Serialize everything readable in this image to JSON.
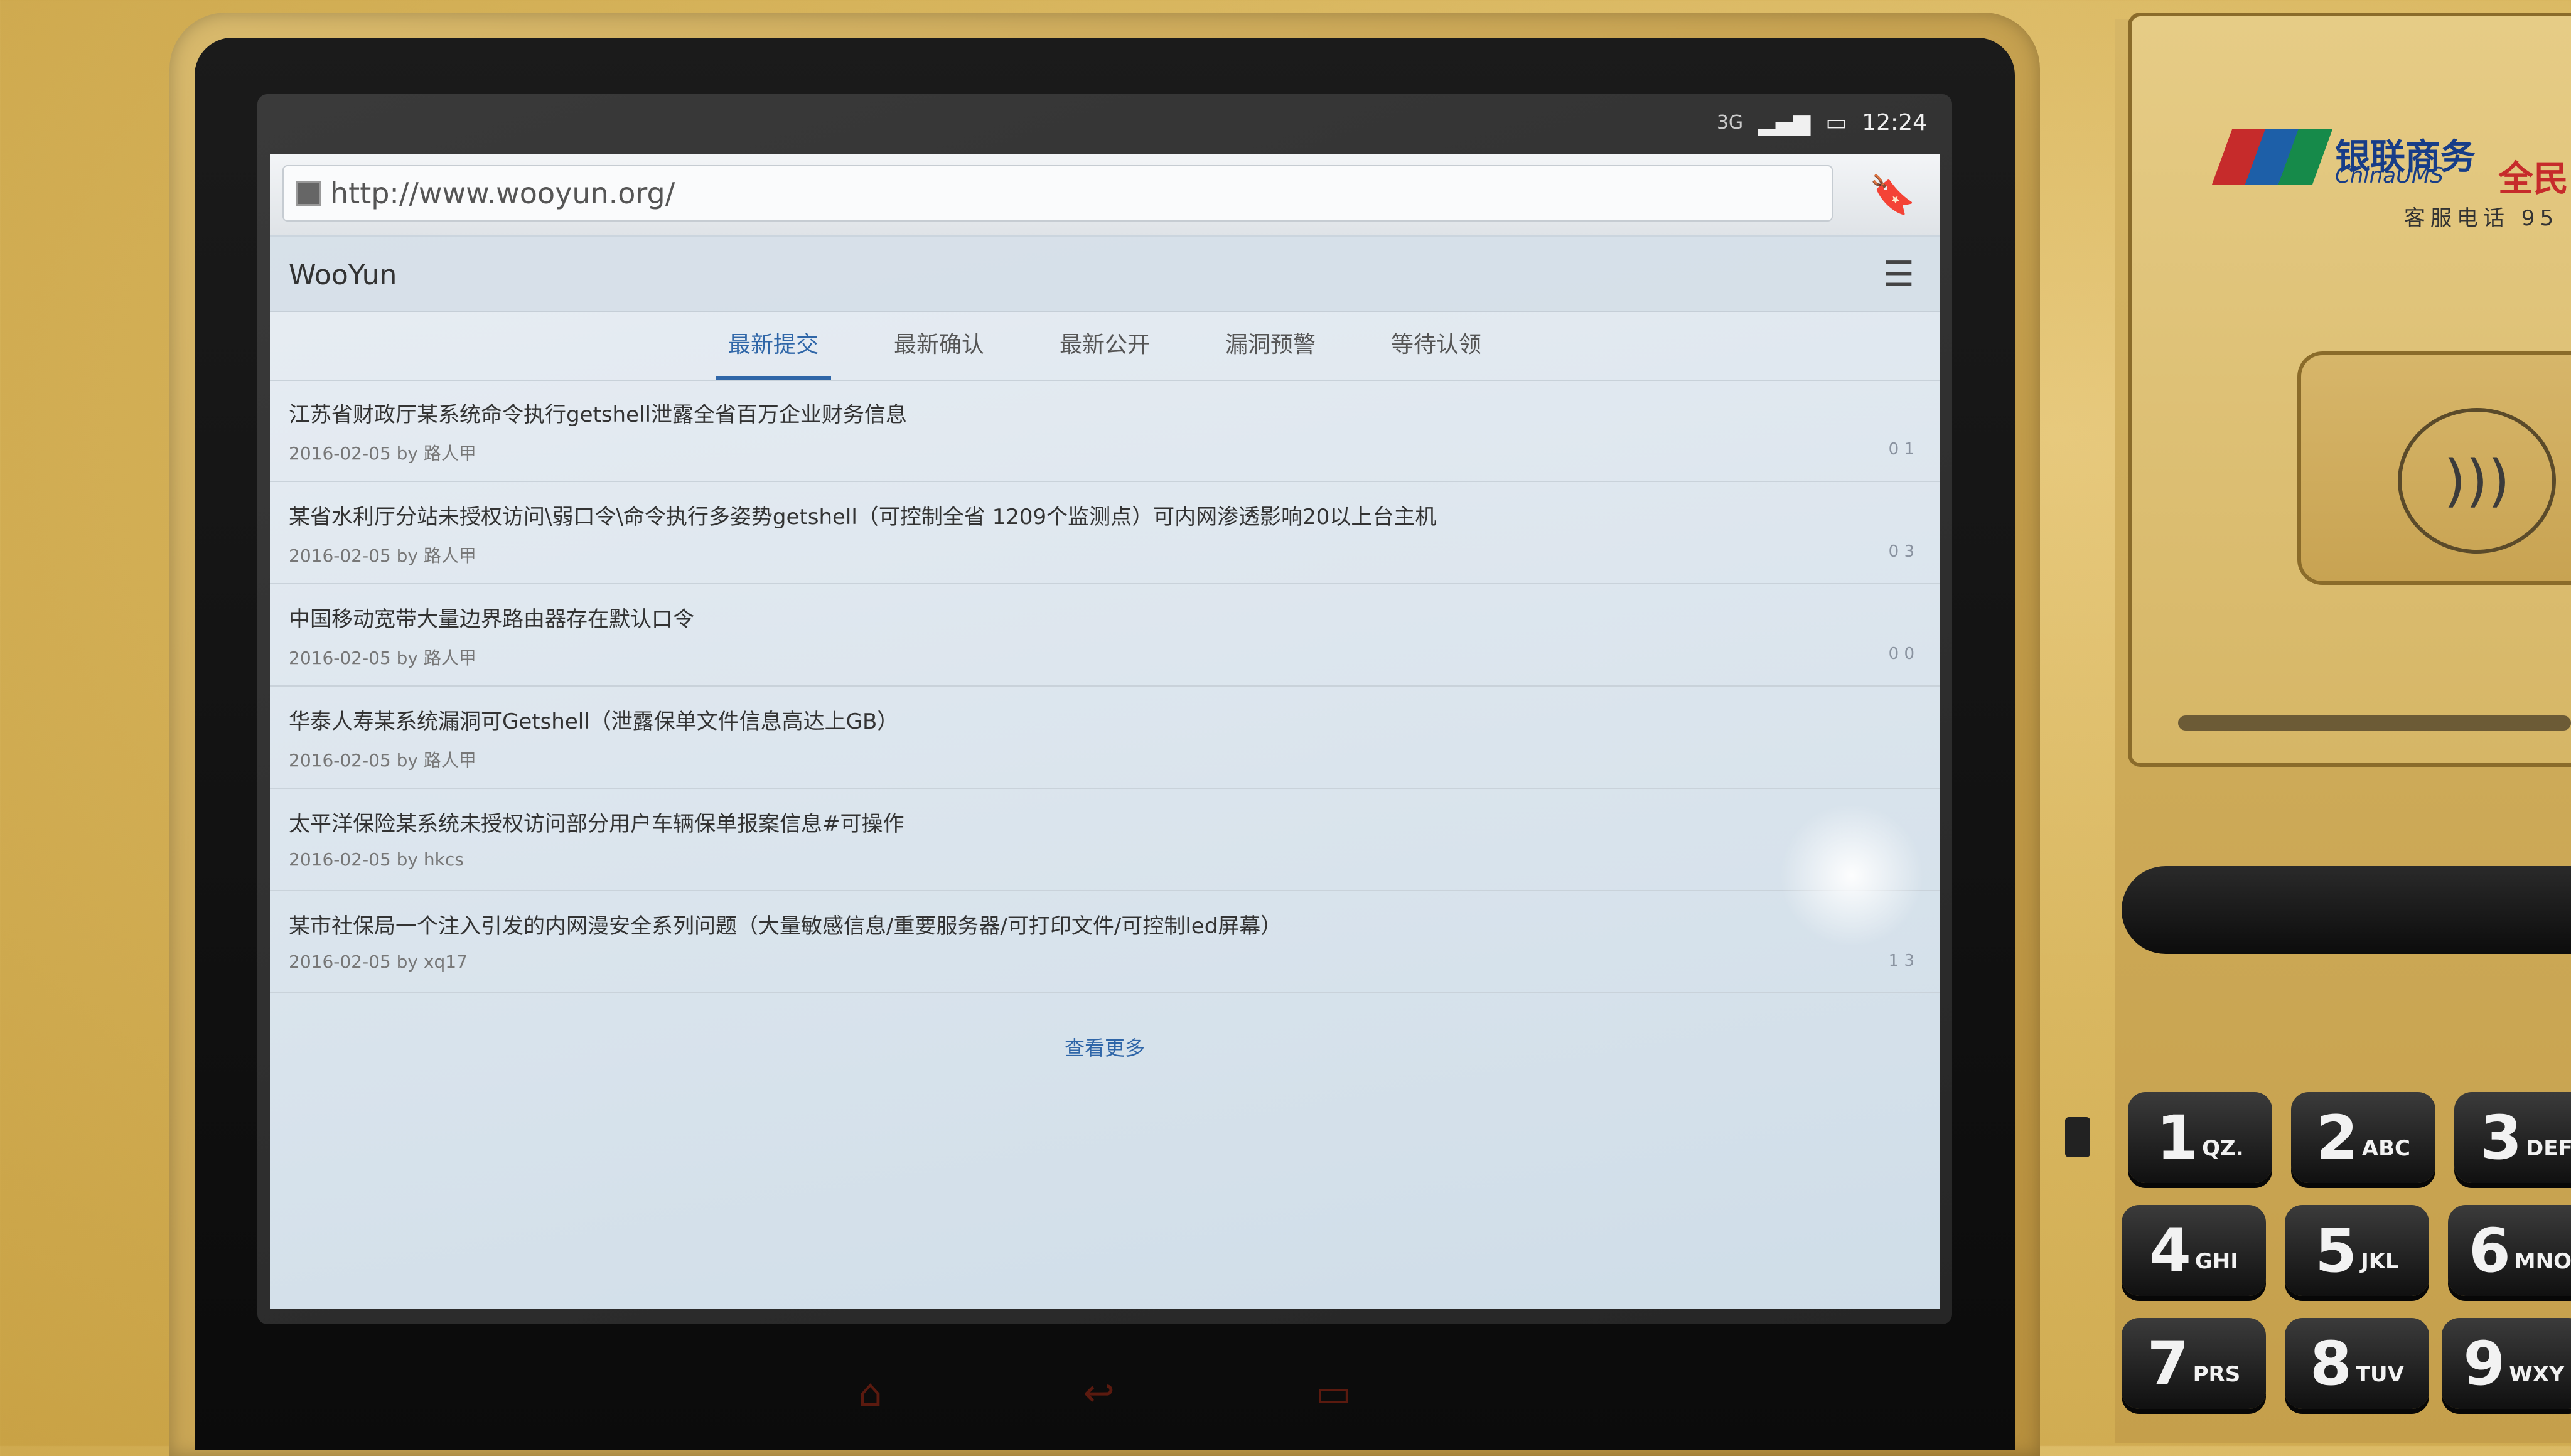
{
  "status": {
    "network": "3G",
    "time": "12:24"
  },
  "browser": {
    "url": "http://www.wooyun.org/",
    "site_name": "WooYun",
    "tabs": [
      {
        "label": "最新提交",
        "active": true
      },
      {
        "label": "最新确认",
        "active": false
      },
      {
        "label": "最新公开",
        "active": false
      },
      {
        "label": "漏洞预警",
        "active": false
      },
      {
        "label": "等待认领",
        "active": false
      }
    ],
    "items": [
      {
        "title": "江苏省财政厅某系统命令执行getshell泄露全省百万企业财务信息",
        "meta": "2016-02-05 by 路人甲",
        "stats": "0  1"
      },
      {
        "title": "某省水利厅分站未授权访问\\弱口令\\命令执行多姿势getshell（可控制全省 1209个监测点）可内网渗透影响20以上台主机",
        "meta": "2016-02-05 by 路人甲",
        "stats": "0  3"
      },
      {
        "title": "中国移动宽带大量边界路由器存在默认口令",
        "meta": "2016-02-05 by 路人甲",
        "stats": "0  0"
      },
      {
        "title": "华泰人寿某系统漏洞可Getshell（泄露保单文件信息高达上GB）",
        "meta": "2016-02-05 by 路人甲",
        "stats": ""
      },
      {
        "title": "太平洋保险某系统未授权访问部分用户车辆保单报案信息#可操作",
        "meta": "2016-02-05 by hkcs",
        "stats": ""
      },
      {
        "title": "某市社保局一个注入引发的内网漫安全系列问题（大量敏感信息/重要服务器/可打印文件/可控制led屏幕）",
        "meta": "2016-02-05 by xq17",
        "stats": "1  3"
      }
    ],
    "more_label": "查看更多"
  },
  "panel": {
    "brand_cn": "银联商务",
    "brand_en": "ChinaUMS",
    "brand_cn2": "全民",
    "hotline": "客服电话 95"
  },
  "keypad": [
    {
      "digit": "1",
      "letters": "QZ."
    },
    {
      "digit": "2",
      "letters": "ABC"
    },
    {
      "digit": "3",
      "letters": "DEF"
    },
    {
      "digit": "4",
      "letters": "GHI"
    },
    {
      "digit": "5",
      "letters": "JKL"
    },
    {
      "digit": "6",
      "letters": "MNO"
    },
    {
      "digit": "7",
      "letters": "PRS"
    },
    {
      "digit": "8",
      "letters": "TUV"
    },
    {
      "digit": "9",
      "letters": "WXY"
    }
  ]
}
